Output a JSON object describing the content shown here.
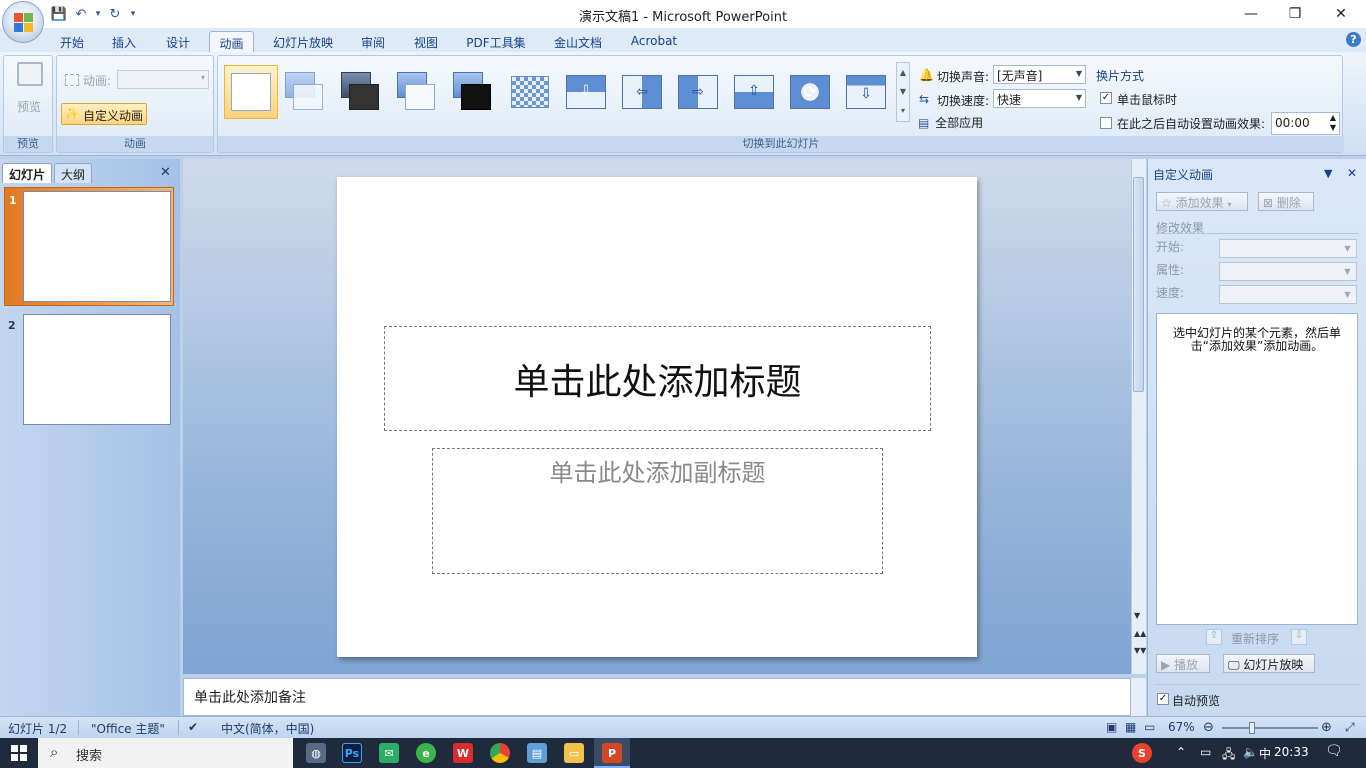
{
  "window": {
    "title": "演示文稿1 - Microsoft PowerPoint",
    "minimize": "—",
    "restore": "❐",
    "close": "✕"
  },
  "qat": [
    "💾",
    "↶",
    "▾",
    "↻",
    "▾"
  ],
  "tabs": [
    "开始",
    "插入",
    "设计",
    "动画",
    "幻灯片放映",
    "审阅",
    "视图",
    "PDF工具集",
    "金山文档",
    "Acrobat"
  ],
  "active_tab": "动画",
  "help": "?",
  "ribbon": {
    "preview": {
      "button": "预览",
      "group_label": "预览"
    },
    "animation": {
      "animate_label": "动画:",
      "custom_anim_button": "自定义动画",
      "group_label": "动画"
    },
    "transition": {
      "group_label": "切换到此幻灯片",
      "sound_label": "切换声音:",
      "sound_value": "[无声音]",
      "speed_label": "切换速度:",
      "speed_value": "快速",
      "apply_all": "全部应用"
    },
    "advance": {
      "heading": "换片方式",
      "on_click_label": "单击鼠标时",
      "on_click_checked": true,
      "auto_label": "在此之后自动设置动画效果:",
      "auto_checked": false,
      "auto_time": "00:00"
    }
  },
  "left_panel": {
    "tab_slides": "幻灯片",
    "tab_outline": "大纲",
    "close": "✕",
    "slides": [
      {
        "num": "1"
      },
      {
        "num": "2"
      }
    ]
  },
  "slide": {
    "title_placeholder": "单击此处添加标题",
    "subtitle_placeholder": "单击此处添加副标题"
  },
  "notes_placeholder": "单击此处添加备注",
  "task_pane": {
    "title": "自定义动画",
    "add_effect": "添加效果",
    "remove": "删除",
    "modify_heading": "修改效果",
    "start_label": "开始:",
    "property_label": "属性:",
    "speed_label": "速度:",
    "hint": "选中幻灯片的某个元素，然后单击“添加效果”添加动画。",
    "reorder": "重新排序",
    "play": "播放",
    "slideshow": "幻灯片放映",
    "auto_preview": "自动预览",
    "auto_preview_checked": true
  },
  "status_bar": {
    "slide_info": "幻灯片 1/2",
    "theme": "\"Office 主题\"",
    "language": "中文(简体，中国)",
    "zoom": "67%"
  },
  "taskbar": {
    "search_placeholder": "搜索",
    "time": "20:33",
    "ime": "中"
  },
  "colors": {
    "accent": "#2b579a",
    "ribbon_bg": "#dfeaf7",
    "selected_item": "#ffd27a",
    "slide_selected_border": "#e07a22"
  }
}
